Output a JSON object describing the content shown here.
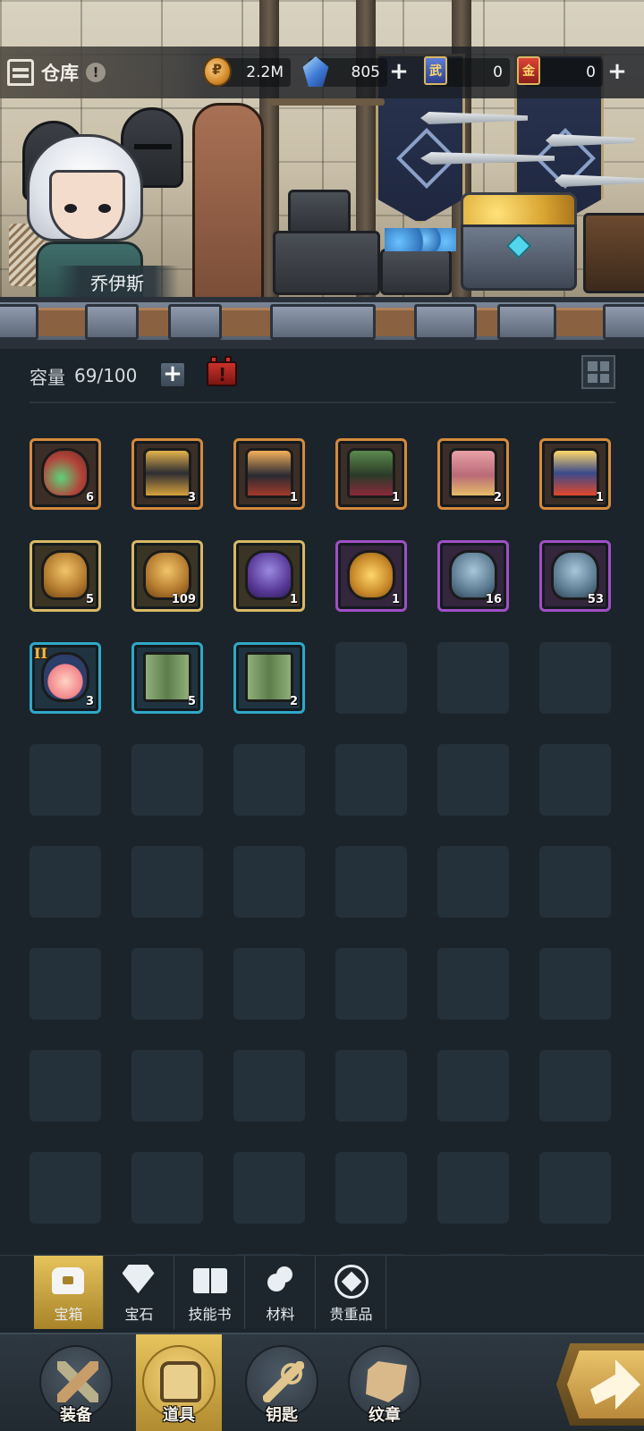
{
  "header": {
    "title": "仓库",
    "info_icon": "!",
    "character_name": "乔伊斯"
  },
  "currencies": [
    {
      "icon": "gold-coin-icon",
      "value": "2.2M",
      "has_plus": false
    },
    {
      "icon": "crystal-icon",
      "value": "805",
      "has_plus": true
    },
    {
      "icon": "blue-ticket-icon",
      "glyph": "武",
      "value": "0",
      "has_plus": false
    },
    {
      "icon": "red-ticket-icon",
      "glyph": "金",
      "value": "0",
      "has_plus": true
    }
  ],
  "capacity": {
    "label": "容量",
    "value": "69/100"
  },
  "inventory": {
    "total_slots": 54,
    "items": [
      {
        "name": "flower-scroll-chest",
        "rarity": "orange",
        "count": "6"
      },
      {
        "name": "black-gold-chest",
        "rarity": "orange",
        "count": "3"
      },
      {
        "name": "dark-sun-chest",
        "rarity": "orange",
        "count": "1"
      },
      {
        "name": "green-goblin-chest",
        "rarity": "orange",
        "count": "1"
      },
      {
        "name": "pink-ornate-chest",
        "rarity": "orange",
        "count": "2"
      },
      {
        "name": "fire-crown-chest",
        "rarity": "orange",
        "count": "1"
      },
      {
        "name": "gold-vase",
        "rarity": "gold",
        "count": "5"
      },
      {
        "name": "gold-vase-large",
        "rarity": "gold",
        "count": "109"
      },
      {
        "name": "purple-vase",
        "rarity": "gold",
        "count": "1"
      },
      {
        "name": "gold-coin-bag",
        "rarity": "purple",
        "count": "1"
      },
      {
        "name": "steel-vase",
        "rarity": "purple",
        "count": "16"
      },
      {
        "name": "steel-vase-blue",
        "rarity": "purple",
        "count": "53"
      },
      {
        "name": "tier-two-bundle",
        "rarity": "blue",
        "count": "3",
        "tier": "II"
      },
      {
        "name": "green-gift-box",
        "rarity": "blue",
        "count": "5"
      },
      {
        "name": "green-gift-box-2",
        "rarity": "blue",
        "count": "2"
      }
    ]
  },
  "categories": [
    {
      "label": "宝箱",
      "icon": "chest-icon",
      "active": true
    },
    {
      "label": "宝石",
      "icon": "gem-icon",
      "active": false
    },
    {
      "label": "技能书",
      "icon": "book-icon",
      "active": false
    },
    {
      "label": "材料",
      "icon": "material-icon",
      "active": false
    },
    {
      "label": "贵重品",
      "icon": "valuable-icon",
      "active": false
    }
  ],
  "bottom_nav": [
    {
      "label": "装备",
      "icon": "equipment-icon",
      "active": false
    },
    {
      "label": "道具",
      "icon": "item-icon",
      "active": true
    },
    {
      "label": "钥匙",
      "icon": "key-icon",
      "active": false
    },
    {
      "label": "纹章",
      "icon": "emblem-icon",
      "active": false
    }
  ],
  "colors": {
    "background": "#1b242b",
    "rarity_orange": "#d68a3c",
    "rarity_gold": "#d8b865",
    "rarity_purple": "#a04fc6",
    "rarity_blue": "#2fa8c8",
    "active_tab": "#e6c35c"
  }
}
